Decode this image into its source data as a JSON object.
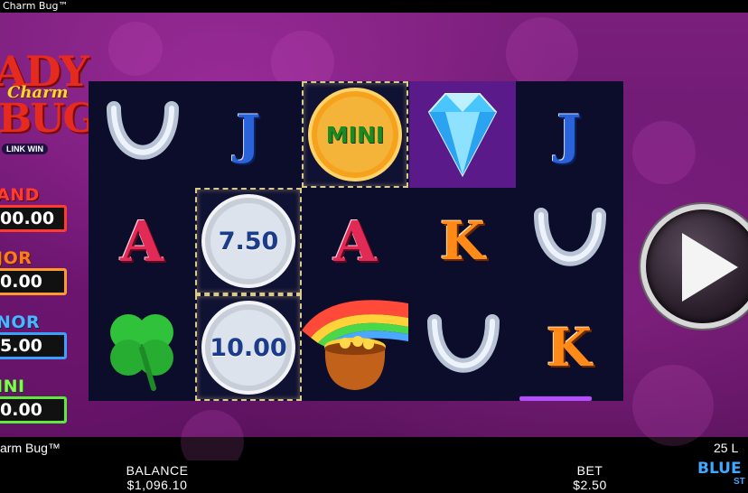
{
  "window": {
    "title": "Charm Bug™"
  },
  "logo": {
    "line1": "ADY",
    "line2": "Charm",
    "line3": "BUG",
    "badge": "LINK WIN"
  },
  "jackpots": [
    {
      "name": "grand",
      "label": "AND",
      "value": "00.00",
      "color": "#ff3b2b"
    },
    {
      "name": "major",
      "label": "JOR",
      "value": "0.00",
      "color": "#ff9a26"
    },
    {
      "name": "minor",
      "label": "NOR",
      "value": "5.00",
      "color": "#3aa0ff"
    },
    {
      "name": "mini",
      "label": "INI",
      "value": "0.00",
      "color": "#5eea3b"
    }
  ],
  "reels": [
    [
      "horseshoe",
      "J",
      "mini-coin",
      "diamond",
      "J"
    ],
    [
      "A",
      "silver-coin",
      "A",
      "K",
      "horseshoe"
    ],
    [
      "clover",
      "silver-coin",
      "pot-of-gold",
      "horseshoe",
      "K"
    ]
  ],
  "coins": {
    "mini": "MINI",
    "r1": "7.50",
    "r2": "10.00"
  },
  "spin": {
    "icon": "play-icon"
  },
  "footer": {
    "game_name": "arm Bug™",
    "lines": "25 L",
    "balance_label": "BALANCE",
    "balance_value": "$1,096.10",
    "bet_label": "BET",
    "bet_value": "$2.50",
    "brand": "BLUE R",
    "brand_sub": "ST"
  },
  "colors": {
    "background": "#6a1870",
    "reel_bg": "#0c0d2a",
    "brand": "#3fa8ff"
  }
}
